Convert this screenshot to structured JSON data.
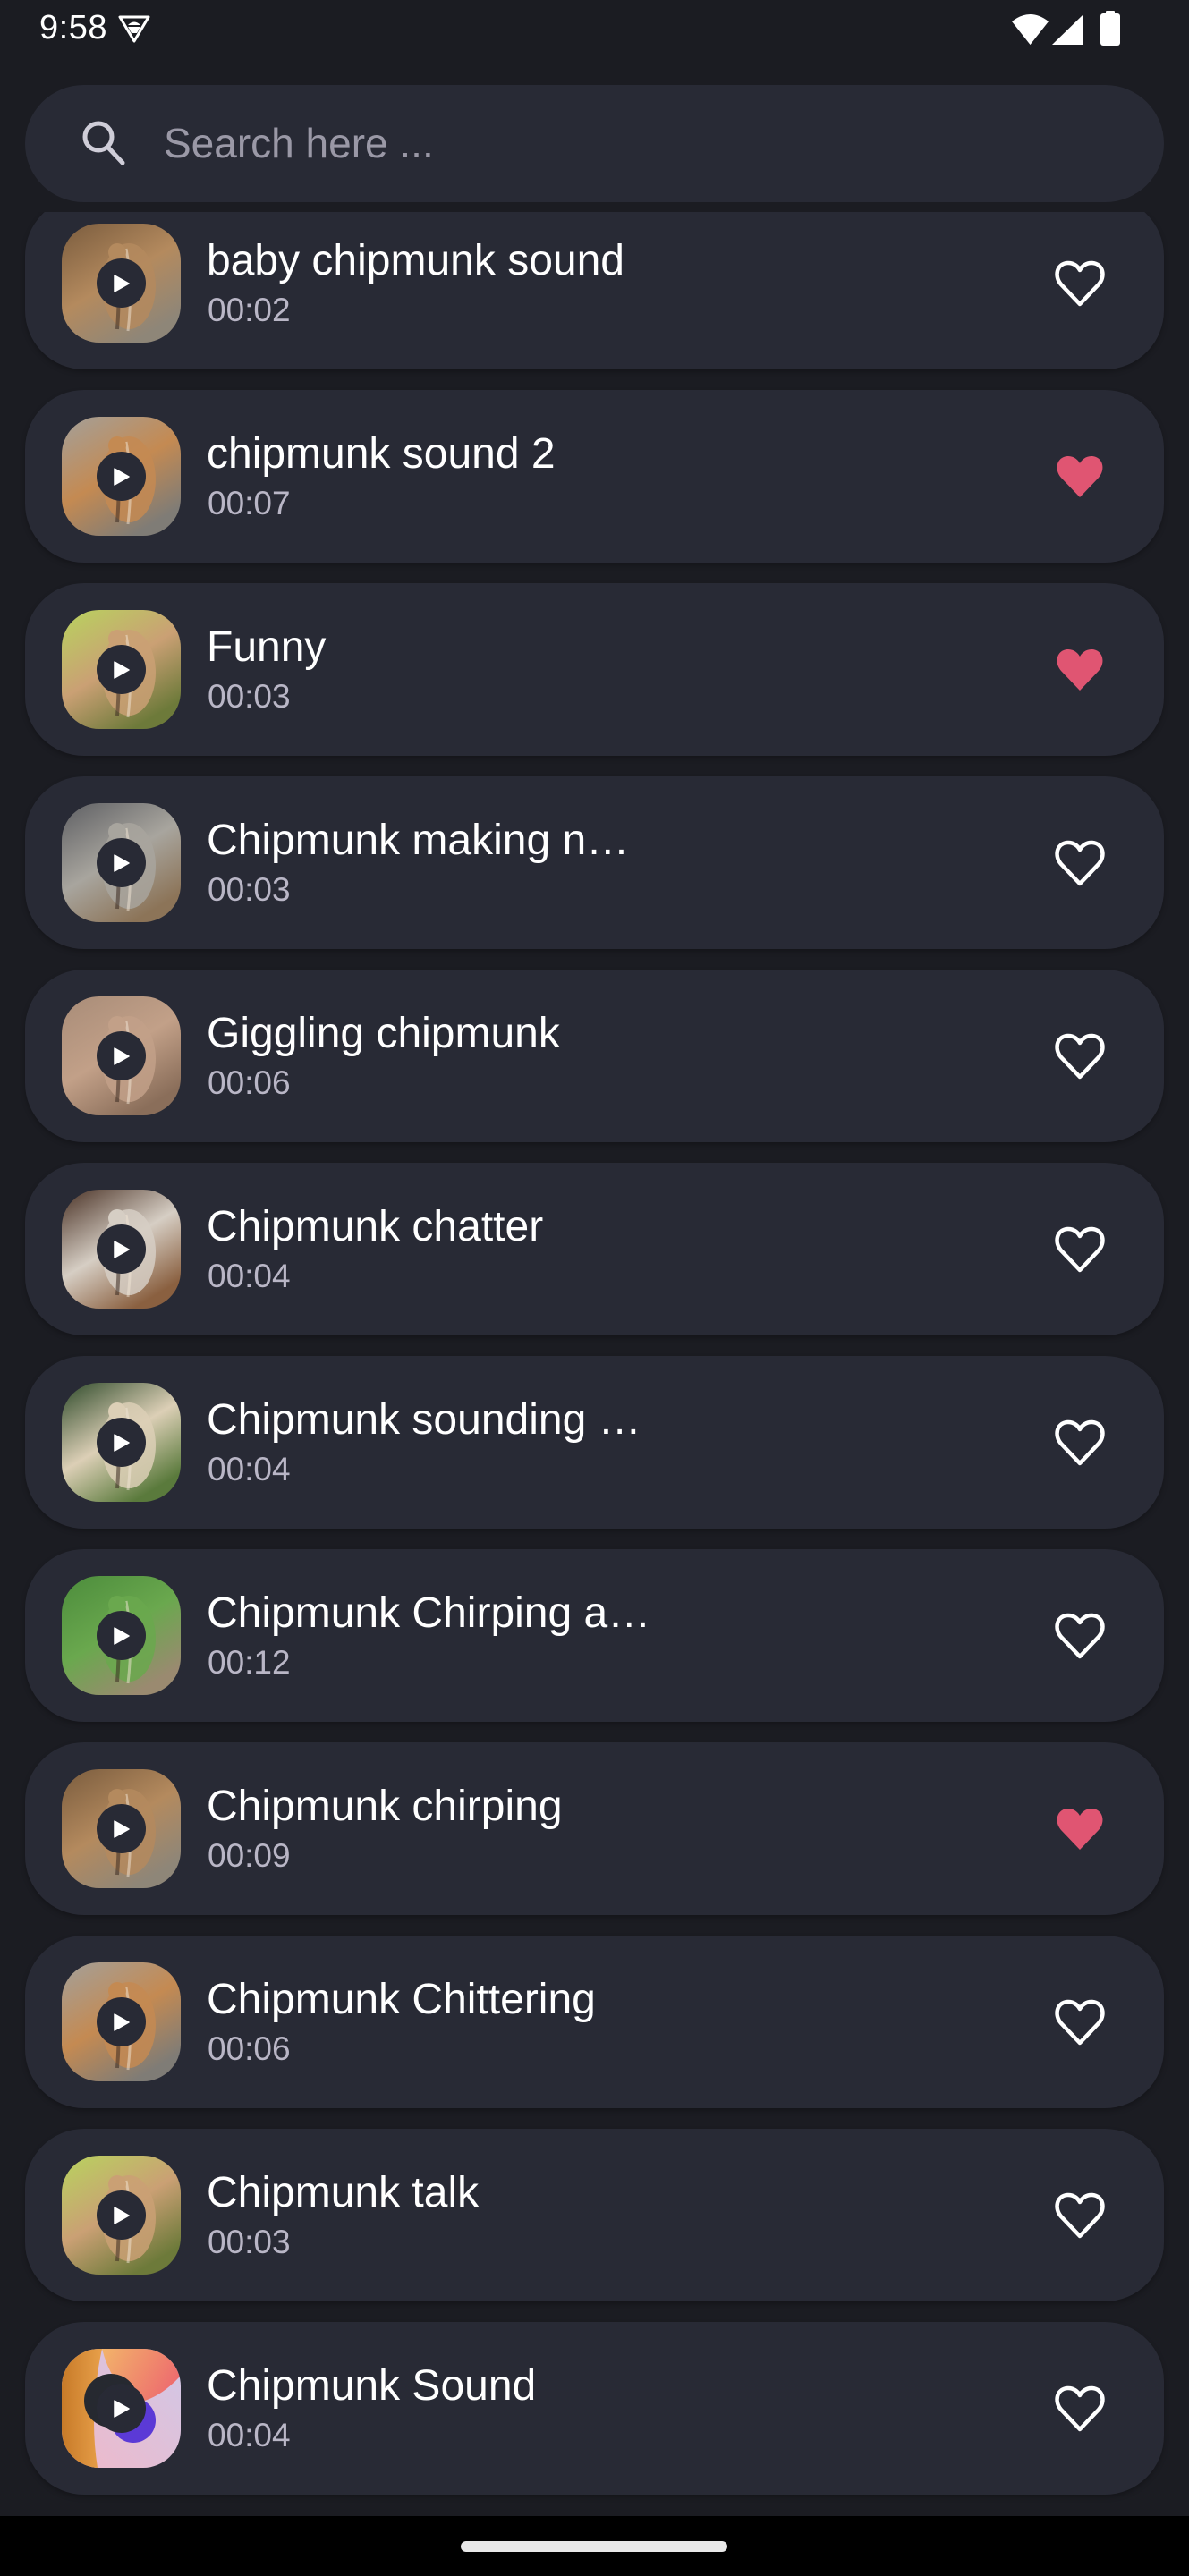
{
  "status_bar": {
    "time": "9:58",
    "icons": [
      "android-debug-icon",
      "wifi-icon",
      "signal-icon",
      "battery-icon"
    ]
  },
  "search": {
    "placeholder": "Search here ...",
    "value": "",
    "icon": "search-icon"
  },
  "colors": {
    "background": "#1b1c22",
    "card": "#282a35",
    "favorite": "#e05572",
    "title_text": "#ffffff",
    "duration_text": "#b9b6c6",
    "placeholder_text": "#9a98a6"
  },
  "sounds": [
    {
      "title": "baby chipmunk sound",
      "duration": "00:02",
      "favorite": false,
      "thumb": [
        "#7a5c3e",
        "#b48a5e",
        "#8e8678"
      ]
    },
    {
      "title": "chipmunk sound 2",
      "duration": "00:07",
      "favorite": true,
      "thumb": [
        "#a3a09a",
        "#c48a52",
        "#7f7c76"
      ]
    },
    {
      "title": "Funny",
      "duration": "00:03",
      "favorite": true,
      "thumb": [
        "#b8d35e",
        "#caa074",
        "#6d7a3a"
      ]
    },
    {
      "title": "Chipmunk making n…",
      "duration": "00:03",
      "favorite": false,
      "thumb": [
        "#5e5f63",
        "#a8a59e",
        "#8c7458"
      ]
    },
    {
      "title": "Giggling chipmunk",
      "duration": "00:06",
      "favorite": false,
      "thumb": [
        "#a88c78",
        "#c2a088",
        "#8a6e5a"
      ]
    },
    {
      "title": "Chipmunk chatter",
      "duration": "00:04",
      "favorite": false,
      "thumb": [
        "#4a3226",
        "#d6cec4",
        "#8a6040"
      ]
    },
    {
      "title": "Chipmunk sounding …",
      "duration": "00:04",
      "favorite": false,
      "thumb": [
        "#2e4a2a",
        "#dccfb6",
        "#5a7a3c"
      ]
    },
    {
      "title": "Chipmunk Chirping a…",
      "duration": "00:12",
      "favorite": false,
      "thumb": [
        "#4c8c3c",
        "#6aa84e",
        "#9a8a70"
      ]
    },
    {
      "title": "Chipmunk chirping",
      "duration": "00:09",
      "favorite": true,
      "thumb": [
        "#7a5c3e",
        "#b48a5e",
        "#8e8678"
      ]
    },
    {
      "title": "Chipmunk Chittering",
      "duration": "00:06",
      "favorite": false,
      "thumb": [
        "#a3a09a",
        "#c48a52",
        "#7f7c76"
      ]
    },
    {
      "title": "Chipmunk talk",
      "duration": "00:03",
      "favorite": false,
      "thumb": [
        "#b8d35e",
        "#caa074",
        "#6d7a3a"
      ]
    },
    {
      "title": "Chipmunk Sound",
      "duration": "00:04",
      "favorite": false,
      "thumb": [
        "#d18a2e",
        "#f0a872",
        "#c9a6e8"
      ],
      "app_icon": true
    }
  ],
  "nav_bar": {
    "home_indicator": "home-indicator"
  }
}
